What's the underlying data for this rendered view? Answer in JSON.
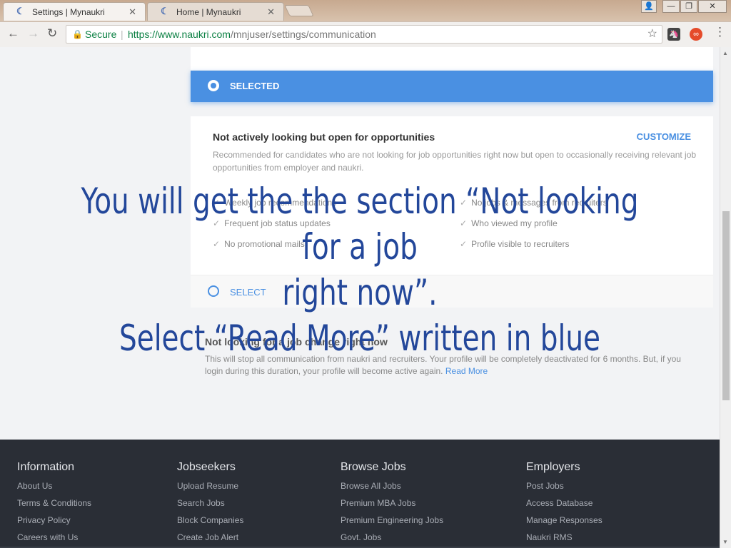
{
  "browser": {
    "tabs": [
      {
        "title": "Settings | Mynaukri",
        "close": "✕"
      },
      {
        "title": "Home | Mynaukri",
        "close": "✕"
      }
    ],
    "secure_label": "Secure",
    "url_host": "https://www.naukri.com",
    "url_path": "/mnjuser/settings/communication"
  },
  "selected_card": {
    "label": "SELECTED"
  },
  "open_card": {
    "title": "Not actively looking but open for opportunities",
    "customize": "CUSTOMIZE",
    "description": "Recommended for candidates who are not looking for job opportunities right now but open to occasionally receiving relevant job opportunities from employer and naukri.",
    "features_left": [
      "Weekly job recommendations",
      "Frequent job status updates",
      "No promotional mails"
    ],
    "features_right": [
      "No jobs & messages from recruiters",
      "Who viewed my profile",
      "Profile visible to recruiters"
    ],
    "select_label": "SELECT"
  },
  "not_looking": {
    "title": "Not looking for a job change right now",
    "description": "This will stop all communication from naukri and recruiters. Your profile will be completely deactivated for 6 months. But, if you login during this duration, your profile will become active again.",
    "read_more": "Read More"
  },
  "footer": {
    "columns": [
      {
        "heading": "Information",
        "links": [
          "About Us",
          "Terms & Conditions",
          "Privacy Policy",
          "Careers with Us"
        ]
      },
      {
        "heading": "Jobseekers",
        "links": [
          "Upload Resume",
          "Search Jobs",
          "Block Companies",
          "Create Job Alert"
        ]
      },
      {
        "heading": "Browse Jobs",
        "links": [
          "Browse All Jobs",
          "Premium MBA Jobs",
          "Premium Engineering Jobs",
          "Govt. Jobs"
        ]
      },
      {
        "heading": "Employers",
        "links": [
          "Post Jobs",
          "Access Database",
          "Manage Responses",
          "Naukri RMS"
        ]
      }
    ]
  },
  "overlay": {
    "line1": "You will get the the section “Not looking for a job",
    "line2": "right now”.",
    "line3": "Select “Read More” written in blue"
  },
  "colors": {
    "accent": "#4a90e2",
    "footer_bg": "#2a2e36",
    "overlay_text": "#23479a"
  }
}
